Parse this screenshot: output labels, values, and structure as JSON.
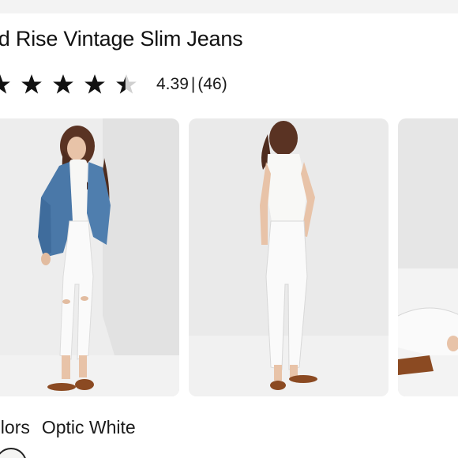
{
  "product": {
    "title": "id Rise Vintage Slim Jeans"
  },
  "rating": {
    "value": "4.39",
    "separator": "|",
    "count": "(46)",
    "stars": [
      "star-full",
      "star-full",
      "star-full",
      "star-full",
      "star-partial"
    ]
  },
  "gallery": {
    "images": [
      {
        "icon": "model-front-photo"
      },
      {
        "icon": "model-back-photo"
      },
      {
        "icon": "model-seated-photo"
      }
    ]
  },
  "colors": {
    "label": "olors",
    "selected": "Optic White"
  },
  "theme": {
    "text": "#1a1a1a",
    "background": "#ffffff",
    "photo_background": "#e6e6e6",
    "denim_blue": "#4a78a8",
    "sandal_brown": "#8b4a22"
  }
}
